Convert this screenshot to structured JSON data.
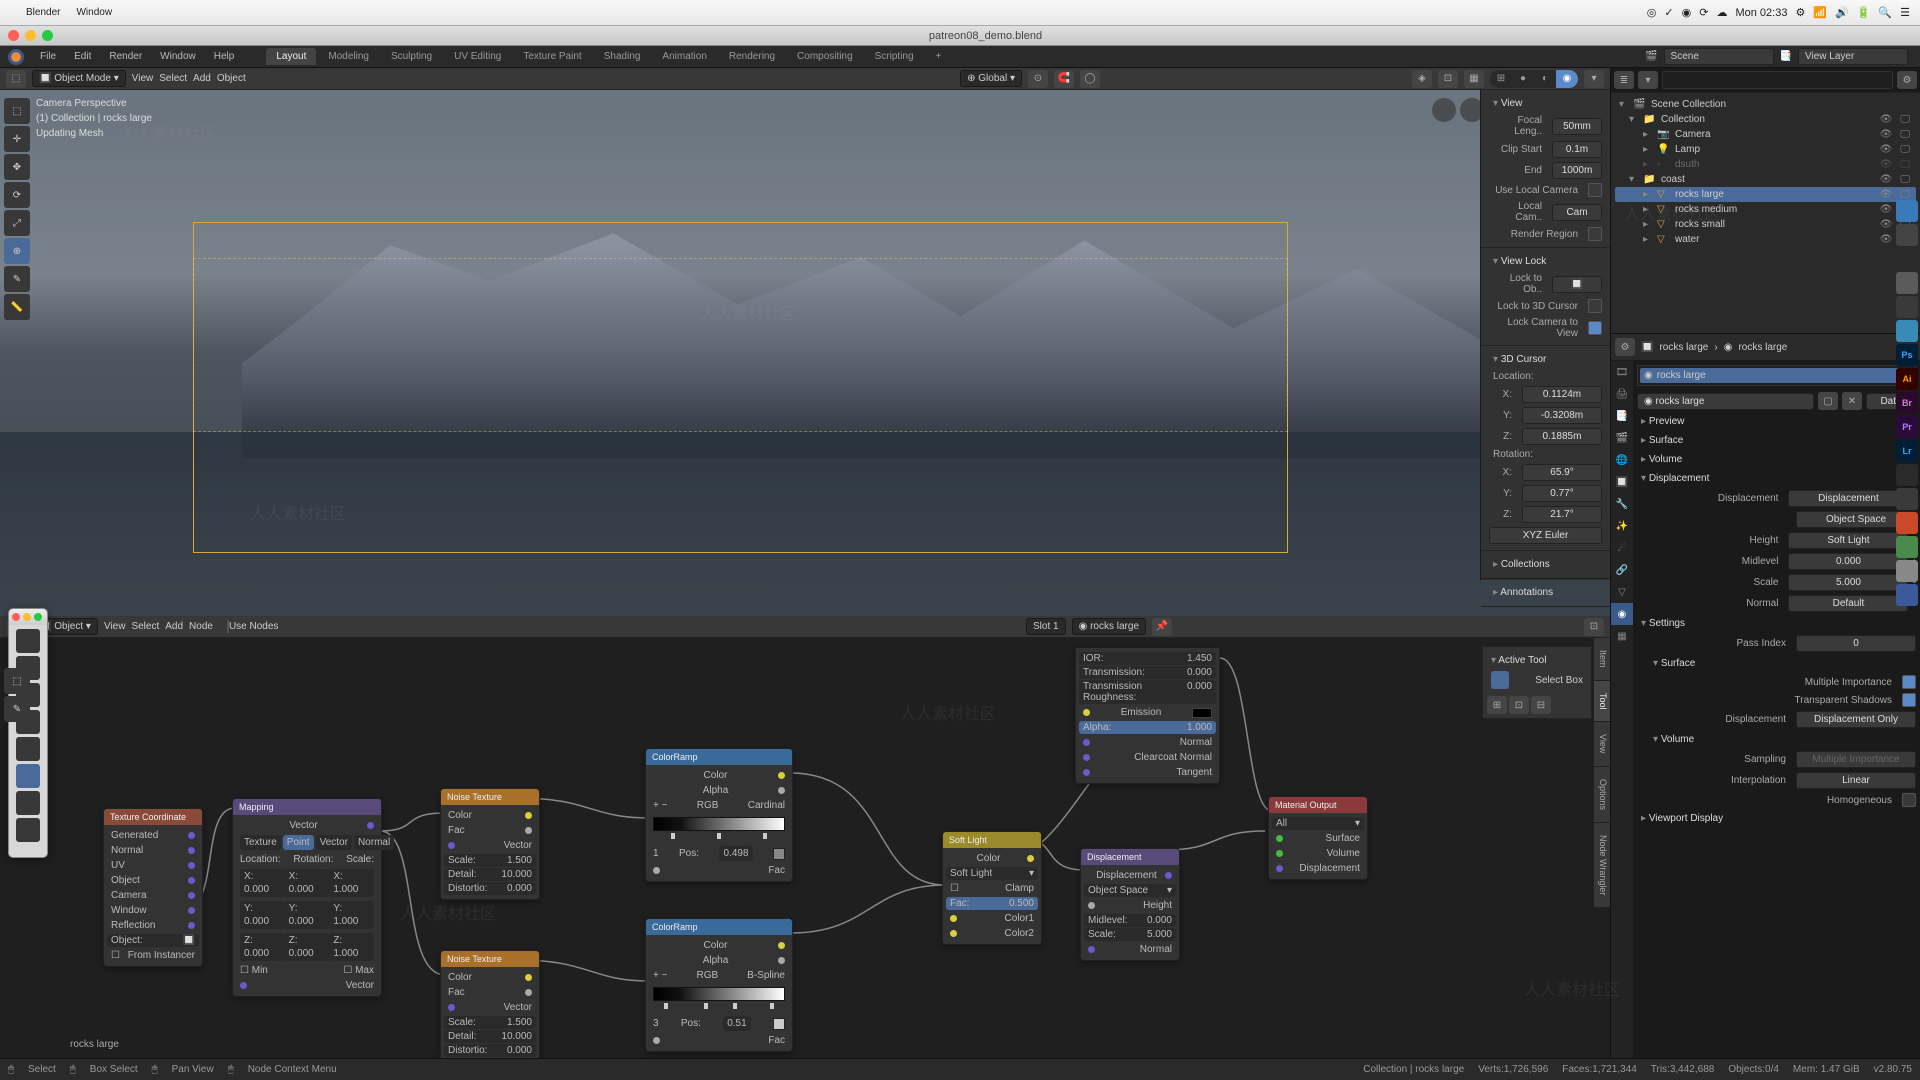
{
  "mac": {
    "app": "Blender",
    "menu2": "Window",
    "clock": "Mon 02:33",
    "battery": "100%"
  },
  "window_title": "patreon08_demo.blend",
  "top_menu": {
    "file": "File",
    "edit": "Edit",
    "render": "Render",
    "window": "Window",
    "help": "Help"
  },
  "workspaces": [
    "Layout",
    "Modeling",
    "Sculpting",
    "UV Editing",
    "Texture Paint",
    "Shading",
    "Animation",
    "Rendering",
    "Compositing",
    "Scripting",
    "+"
  ],
  "scene_label": "Scene",
  "scene": "Scene",
  "layer_label": "View Layer",
  "layer": "View Layer",
  "viewport_header": {
    "mode": "Object Mode",
    "view": "View",
    "select": "Select",
    "add": "Add",
    "object": "Object",
    "orientation": "Global"
  },
  "viewport_overlay": {
    "l1": "Camera Perspective",
    "l2": "(1) Collection | rocks large",
    "l3": "Updating Mesh"
  },
  "n_panel": {
    "view": "View",
    "focal": "Focal Leng..",
    "focal_v": "50mm",
    "clip_start": "Clip Start",
    "clip_start_v": "0.1m",
    "clip_end": "End",
    "clip_end_v": "1000m",
    "local_cam": "Use Local Camera",
    "local_cam2": "Local Cam..",
    "local_cam2_v": "Cam",
    "render_region": "Render Region",
    "view_lock": "View Lock",
    "lock_obj": "Lock to Ob..",
    "lock_cursor": "Lock to 3D Cursor",
    "lock_cam": "Lock Camera to View",
    "cursor": "3D Cursor",
    "location": "Location:",
    "x": "X:",
    "x_v": "0.1124m",
    "y": "Y:",
    "y_v": "-0.3208m",
    "z": "Z:",
    "z_v": "0.1885m",
    "rotation": "Rotation:",
    "rx": "X:",
    "rx_v": "65.9°",
    "ry": "Y:",
    "ry_v": "0.77°",
    "rz": "Z:",
    "rz_v": "21.7°",
    "rot_mode": "XYZ Euler",
    "collections": "Collections",
    "annotations": "Annotations",
    "tabs": [
      "Item",
      "Tool",
      "View"
    ]
  },
  "node_header": {
    "view": "View",
    "select": "Select",
    "add": "Add",
    "node": "Node",
    "use_nodes": "Use Nodes",
    "object": "Object",
    "slot": "Slot 1",
    "material": "rocks large"
  },
  "node_side_tabs": [
    "Item",
    "Tool",
    "View",
    "Options",
    "Node Wrangler"
  ],
  "active_tool": {
    "header": "Active Tool",
    "name": "Select Box"
  },
  "nodes": {
    "texcoord": {
      "title": "Texture Coordinate",
      "outs": [
        "Generated",
        "Normal",
        "UV",
        "Object",
        "Camera",
        "Window",
        "Reflection"
      ],
      "obj": "Object:",
      "from_inst": "From Instancer"
    },
    "mapping": {
      "title": "Mapping",
      "out": "Vector",
      "type_row": [
        "Texture",
        "Point",
        "Vector",
        "Normal"
      ],
      "headers": [
        "Location:",
        "Rotation:",
        "Scale:"
      ],
      "loc": [
        "X: 0.000",
        "Y: 0.000",
        "Z: 0.000"
      ],
      "rot": [
        "X: 0.000",
        "Y: 0.000",
        "Z: 0.000"
      ],
      "scl": [
        "X: 1.000",
        "Y: 1.000",
        "Z: 1.000"
      ],
      "min": "Min",
      "max": "Max",
      "in": "Vector"
    },
    "noise1": {
      "title": "Noise Texture",
      "outs": [
        "Color",
        "Fac"
      ],
      "in": "Vector",
      "scale": "Scale:",
      "scale_v": "1.500",
      "detail": "Detail:",
      "detail_v": "10.000",
      "dist": "Distortio:",
      "dist_v": "0.000"
    },
    "noise2": {
      "title": "Noise Texture",
      "outs": [
        "Color",
        "Fac"
      ],
      "in": "Vector",
      "scale": "Scale:",
      "scale_v": "1.500",
      "detail": "Detail:",
      "detail_v": "10.000",
      "dist": "Distortio:",
      "dist_v": "0.000"
    },
    "ramp1": {
      "title": "ColorRamp",
      "outs": [
        "Color",
        "Alpha"
      ],
      "mode": "RGB",
      "interp": "Cardinal",
      "pos": "Pos:",
      "pos_v": "0.498",
      "in": "Fac"
    },
    "ramp2": {
      "title": "ColorRamp",
      "outs": [
        "Color",
        "Alpha"
      ],
      "mode": "RGB",
      "interp": "B-Spline",
      "pos": "Pos:",
      "pos_v": "0.51",
      "idx": "3",
      "in": "Fac"
    },
    "mix": {
      "title": "Soft Light",
      "out": "Color",
      "blend": "Soft Light",
      "clamp": "Clamp",
      "fac": "Fac:",
      "fac_v": "0.500",
      "c1": "Color1",
      "c2": "Color2"
    },
    "disp": {
      "title": "Displacement",
      "out": "Displacement",
      "space": "Object Space",
      "h": "Height",
      "mid": "Midlevel:",
      "mid_v": "0.000",
      "scale": "Scale:",
      "scale_v": "5.000",
      "norm": "Normal"
    },
    "bsdf": {
      "rows": [
        [
          "IOR:",
          "1.450"
        ],
        [
          "Transmission:",
          "0.000"
        ],
        [
          "Transmission Roughness:",
          "0.000"
        ],
        [
          "Emission",
          ""
        ],
        [
          "Alpha:",
          "1.000"
        ],
        [
          "Normal",
          ""
        ],
        [
          "Clearcoat Normal",
          ""
        ],
        [
          "Tangent",
          ""
        ]
      ]
    },
    "output": {
      "title": "Material Output",
      "target": "All",
      "ins": [
        "Surface",
        "Volume",
        "Displacement"
      ]
    }
  },
  "outliner": {
    "search_placeholder": "",
    "root": "Scene Collection",
    "items": [
      {
        "indent": 1,
        "name": "Collection",
        "icon": "📁",
        "expanded": true
      },
      {
        "indent": 2,
        "name": "Camera",
        "icon": "📷"
      },
      {
        "indent": 2,
        "name": "Lamp",
        "icon": "💡"
      },
      {
        "indent": 2,
        "name": "dsuth",
        "icon": "▫",
        "disabled": true
      },
      {
        "indent": 1,
        "name": "coast",
        "icon": "📁",
        "expanded": true
      },
      {
        "indent": 2,
        "name": "rocks large",
        "icon": "▽",
        "selected": true
      },
      {
        "indent": 2,
        "name": "rocks medium",
        "icon": "▽"
      },
      {
        "indent": 2,
        "name": "rocks small",
        "icon": "▽"
      },
      {
        "indent": 2,
        "name": "water",
        "icon": "▽"
      }
    ]
  },
  "props": {
    "breadcrumb1": "rocks large",
    "breadcrumb2": "rocks large",
    "mat_field": "rocks large",
    "data_link": "Data",
    "preview": "Preview",
    "surface": "Surface",
    "volume": "Volume",
    "displacement": "Displacement",
    "disp": {
      "l": "Displacement",
      "v": "Displacement",
      "space": "Object Space",
      "height_l": "Height",
      "height_v": "Soft Light",
      "mid": "Midlevel",
      "mid_v": "0.000",
      "scale": "Scale",
      "scale_v": "5.000",
      "norm": "Normal",
      "norm_v": "Default"
    },
    "settings": "Settings",
    "pass_idx": "Pass Index",
    "pass_idx_v": "0",
    "surf2": "Surface",
    "multi_imp": "Multiple Importance",
    "transp_shadow": "Transparent Shadows",
    "disp_method_l": "Displacement",
    "disp_method_v": "Displacement Only",
    "vol": "Volume",
    "sampling": "Sampling",
    "sampling_v": "Multiple Importance",
    "interp": "Interpolation",
    "interp_v": "Linear",
    "homog": "Homogeneous",
    "vp_display": "Viewport Display"
  },
  "context_obj": "rocks large",
  "status": {
    "select": "Select",
    "box": "Box Select",
    "pan": "Pan View",
    "ctx": "Node Context Menu",
    "path": "Collection | rocks large",
    "verts": "Verts:1,726,596",
    "faces": "Faces:1,721,344",
    "tris": "Tris:3,442,688",
    "objs": "Objects:0/4",
    "mem": "Mem: 1.47 GiB",
    "ver": "v2.80.75"
  }
}
